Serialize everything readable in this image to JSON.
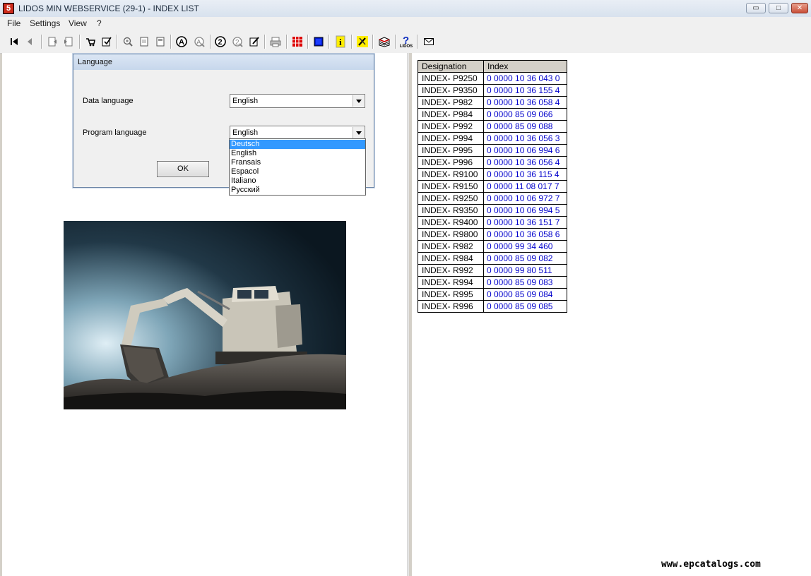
{
  "window": {
    "title": "LIDOS MIN WEBSERVICE (29-1) - INDEX LIST",
    "app_icon_label": "5",
    "buttons": {
      "minimize": "▭",
      "maximize": "□",
      "close": "✕"
    }
  },
  "menu": [
    "File",
    "Settings",
    "View",
    "?"
  ],
  "toolbar": {
    "icons": [
      "first-page-icon",
      "previous-icon",
      "back-document-icon",
      "forward-document-icon",
      "cart-icon",
      "checklist-icon",
      "zoom-in-icon",
      "page-icon",
      "page-copy-icon",
      "search-a-icon",
      "search-a-off-icon",
      "circle-two-icon",
      "circle-two-off-icon",
      "edit-icon",
      "printer-icon",
      "grid-red-icon",
      "blue-square-icon",
      "info-icon",
      "tools-icon",
      "book-icon",
      "help-lidos-icon",
      "mail-icon"
    ],
    "help_label": "LIDOS"
  },
  "dialog": {
    "title": "Language",
    "data_language_label": "Data language",
    "data_language_value": "English",
    "program_language_label": "Program language",
    "program_language_value": "English",
    "ok_label": "OK",
    "options": [
      "Deutsch",
      "English",
      "Fransais",
      "Espacol",
      "Italiano",
      "Русский"
    ],
    "selected_option": "Deutsch"
  },
  "index_table": {
    "headers": [
      "Designation",
      "Index"
    ],
    "rows": [
      [
        "INDEX- P9250",
        "0 0000 10 36 043 0"
      ],
      [
        "INDEX- P9350",
        "0 0000 10 36 155 4"
      ],
      [
        "INDEX- P982",
        "0 0000 10 36 058 4"
      ],
      [
        "INDEX- P984",
        "0 0000 85 09 066"
      ],
      [
        "INDEX- P992",
        "0 0000 85 09 088"
      ],
      [
        "INDEX- P994",
        "0 0000 10 36 056 3"
      ],
      [
        "INDEX- P995",
        "0 0000 10 06 994 6"
      ],
      [
        "INDEX- P996",
        "0 0000 10 36 056 4"
      ],
      [
        "INDEX- R9100",
        "0 0000 10 36 115 4"
      ],
      [
        "INDEX- R9150",
        "0 0000 11 08 017 7"
      ],
      [
        "INDEX- R9250",
        "0 0000 10 06 972 7"
      ],
      [
        "INDEX- R9350",
        "0 0000 10 06 994 5"
      ],
      [
        "INDEX- R9400",
        "0 0000 10 36 151 7"
      ],
      [
        "INDEX- R9800",
        "0 0000 10 36 058 6"
      ],
      [
        "INDEX- R982",
        "0 0000 99 34 460"
      ],
      [
        "INDEX- R984",
        "0 0000 85 09 082"
      ],
      [
        "INDEX- R992",
        "0 0000 99 80 511"
      ],
      [
        "INDEX- R994",
        "0 0000 85 09 083"
      ],
      [
        "INDEX- R995",
        "0 0000 85 09 084"
      ],
      [
        "INDEX- R996",
        "0 0000 85 09 085"
      ]
    ]
  },
  "watermark": "www.epcatalogs.com",
  "colors": {
    "index_value": "#0000cc",
    "selection": "#3399ff"
  }
}
